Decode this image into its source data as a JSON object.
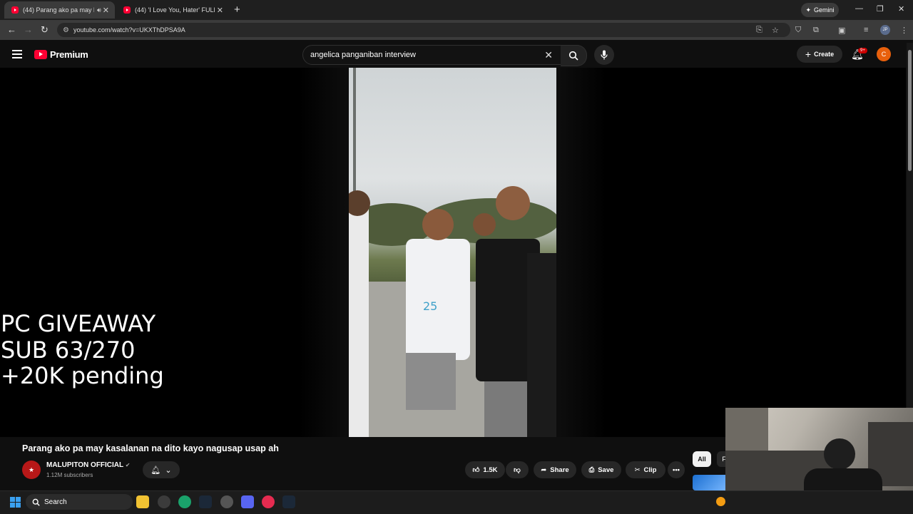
{
  "browser": {
    "tabs": [
      {
        "title": "(44) Parang ako pa may kas",
        "active": true
      },
      {
        "title": "(44) 'I Love You, Hater' FULL M",
        "active": false
      }
    ],
    "new_tab_symbol": "+",
    "gemini_label": "Gemini",
    "url": "youtube.com/watch?v=UKXThDPSA9A",
    "profile_initials": "JP"
  },
  "youtube": {
    "brand": "Premium",
    "search_query": "angelica panganiban interview",
    "create_label": "Create",
    "notifications_badge": "9+",
    "avatar_initial": "C"
  },
  "overlay": {
    "line1": "PC GIVEAWAY",
    "line2": "SUB 63/270",
    "line3": "+20K pending"
  },
  "video": {
    "title": "Parang ako pa may kasalanan na dito kayo nagusap usap ah",
    "channel": "MALUPITON OFFICIAL",
    "subscribers": "1.12M subscribers",
    "likes": "1.5K",
    "share_label": "Share",
    "save_label": "Save",
    "clip_label": "Clip",
    "more_label": "•••"
  },
  "sidebar_chips": {
    "all": "All",
    "second": "F"
  },
  "taskbar": {
    "search_label": "Search"
  },
  "colors": {
    "youtube_red": "#ff0033",
    "background": "#0f0f0f",
    "avatar_orange": "#e8600c"
  }
}
